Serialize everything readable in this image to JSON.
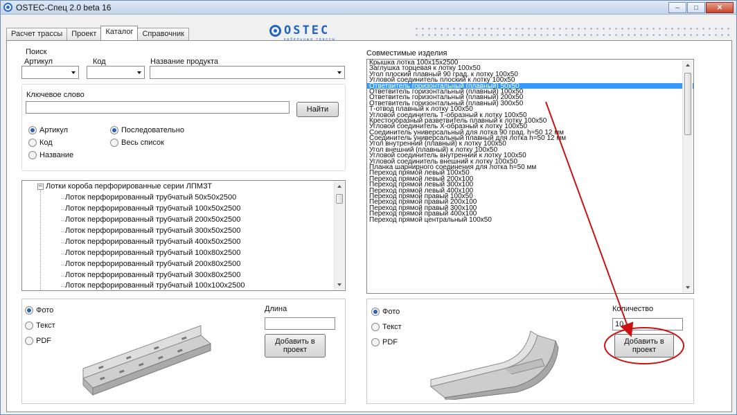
{
  "window": {
    "title": "OSTEC-Спец 2.0 beta 16",
    "minimize": "–",
    "maximize": "□",
    "close": "✕"
  },
  "tabs": [
    "Расчет трассы",
    "Проект",
    "Каталог",
    "Справочник"
  ],
  "logo": {
    "text": "OSTEC",
    "sub": "кабельные трассы"
  },
  "search": {
    "title": "Поиск",
    "article_label": "Артикул",
    "code_label": "Код",
    "name_label": "Название продукта",
    "keyword_label": "Ключевое слово",
    "keyword_value": "",
    "find_button": "Найти",
    "radio_field": [
      {
        "label": "Артикул",
        "checked": true
      },
      {
        "label": "Код",
        "checked": false
      },
      {
        "label": "Название",
        "checked": false
      }
    ],
    "radio_mode": [
      {
        "label": "Последовательно",
        "checked": true
      },
      {
        "label": "Весь список",
        "checked": false
      }
    ]
  },
  "tree": {
    "root": "Лотки короба перфорированные серии ЛПМЗТ",
    "items": [
      "Лоток перфорированный трубчатый 50x50x2500",
      "Лоток перфорированный трубчатый 100x50x2500",
      "Лоток перфорированный трубчатый 200x50x2500",
      "Лоток перфорированный трубчатый 300x50x2500",
      "Лоток перфорированный трубчатый 400x50x2500",
      "Лоток перфорированный трубчатый 100x80x2500",
      "Лоток перфорированный трубчатый 200x80x2500",
      "Лоток перфорированный трубчатый 300x80x2500",
      "Лоток перфорированный трубчатый 100x100x2500"
    ]
  },
  "compatible": {
    "title": "Совместимые изделия",
    "selected_index": 4,
    "items": [
      "Крышка лотка 100x15x2500",
      "Заглушка торцевая к лотку 100x50",
      "Угол плоский плавный 90 град. к лотку 100x50",
      "Угловой соединитель плоский к лотку 100x50",
      "Ответвитель горизонтальный (плавный) 50x50",
      "Ответвитель горизонтальный (плавный) 100x50",
      "Ответвитель горизонтальный (плавный) 200x50",
      "Ответвитель горизонтальный (плавный) 300x50",
      "Т-отвод плавный к лотку 100x50",
      "Угловой соединитель Т-образный к лотку 100x50",
      "Крестообразный разветвитель плавный к лотку 100x50",
      "Угловой соединитель Х-образный к лотку 100x50",
      "Соединитель универсальный для лотка 90 град. h=50 12 мм",
      "Соединитель универсальный плавный для лотка h=50 12 мм",
      "Угол внутренний (плавный) к лотку 100x50",
      "Угол внешний (плавный) к лотку 100x50",
      "Угловой соединитель внутренний к лотку 100x50",
      "Угловой соединитель внешний к лотку 100x50",
      "Планка шарнирного соединения для лотка h=50 мм",
      "Переход прямой левый 100x50",
      "Переход прямой левый 200x100",
      "Переход прямой левый 300x100",
      "Переход прямой левый 400x100",
      "Переход прямой правый 100x50",
      "Переход прямой правый 200x100",
      "Переход прямой правый 300x100",
      "Переход прямой правый 400x100",
      "Переход прямой центральный 100x50"
    ]
  },
  "left_preview": {
    "radios": [
      {
        "label": "Фото",
        "checked": true
      },
      {
        "label": "Текст",
        "checked": false
      },
      {
        "label": "PDF",
        "checked": false
      }
    ],
    "length_label": "Длина",
    "length_value": "",
    "add_button": "Добавить в проект"
  },
  "right_preview": {
    "radios": [
      {
        "label": "Фото",
        "checked": true
      },
      {
        "label": "Текст",
        "checked": false
      },
      {
        "label": "PDF",
        "checked": false
      }
    ],
    "qty_label": "Количество",
    "qty_value": "10",
    "add_button": "Добавить в проект"
  },
  "colors": {
    "accent": "#3399ff",
    "annotation": "#cc1111",
    "logo": "#1f63c6"
  }
}
